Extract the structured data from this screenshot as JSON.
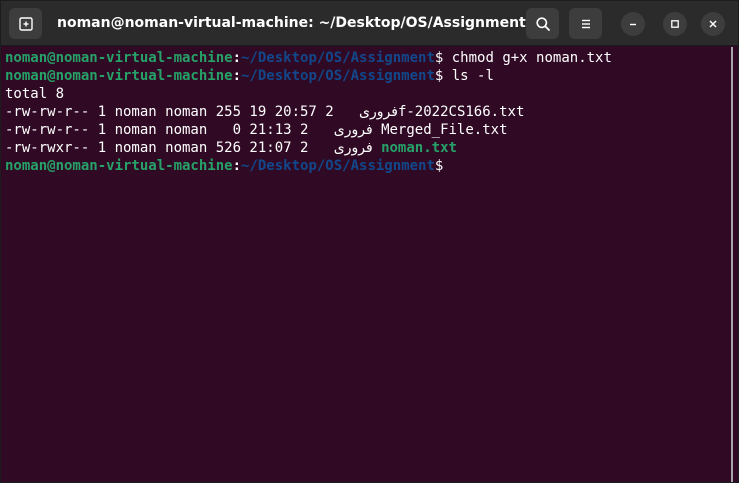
{
  "window": {
    "title": "noman@noman-virtual-machine: ~/Desktop/OS/Assignment"
  },
  "headerbar": {
    "new_tab_icon": "new-tab-icon",
    "search_icon": "search-icon",
    "menu_icon": "hamburger-menu-icon",
    "minimize_icon": "minimize-icon",
    "maximize_icon": "maximize-icon",
    "close_icon": "close-icon"
  },
  "colors": {
    "terminal_background": "#300a24",
    "prompt_user": "#26a269",
    "prompt_path": "#12488b",
    "executable_file": "#26a269",
    "headerbar": "#2b2b2b"
  },
  "terminal": {
    "prompts": [
      {
        "user_host": "noman@noman-virtual-machine",
        "colon": ":",
        "path": "~/Desktop/OS/Assignment",
        "dollar": "$",
        "command": " chmod g+x noman.txt"
      },
      {
        "user_host": "noman@noman-virtual-machine",
        "colon": ":",
        "path": "~/Desktop/OS/Assignment",
        "dollar": "$",
        "command": " ls -l"
      }
    ],
    "total_line": "total 8",
    "listing": [
      {
        "meta": "-rw-rw-r-- 1 noman noman 255 19 20:57 2",
        "month": "فروری",
        "spacer": "",
        "name": "f-2022CS166.txt",
        "executable": false
      },
      {
        "meta": "-rw-rw-r-- 1 noman noman   0 21:13 2",
        "month": "فروری",
        "spacer": " ",
        "name": "Merged_File.txt",
        "executable": false
      },
      {
        "meta": "-rw-rwxr-- 1 noman noman 526 21:07 2",
        "month": "فروری",
        "spacer": " ",
        "name": "noman.txt",
        "executable": true
      }
    ],
    "final_prompt": {
      "user_host": "noman@noman-virtual-machine",
      "colon": ":",
      "path": "~/Desktop/OS/Assignment",
      "dollar": "$",
      "command": ""
    }
  }
}
